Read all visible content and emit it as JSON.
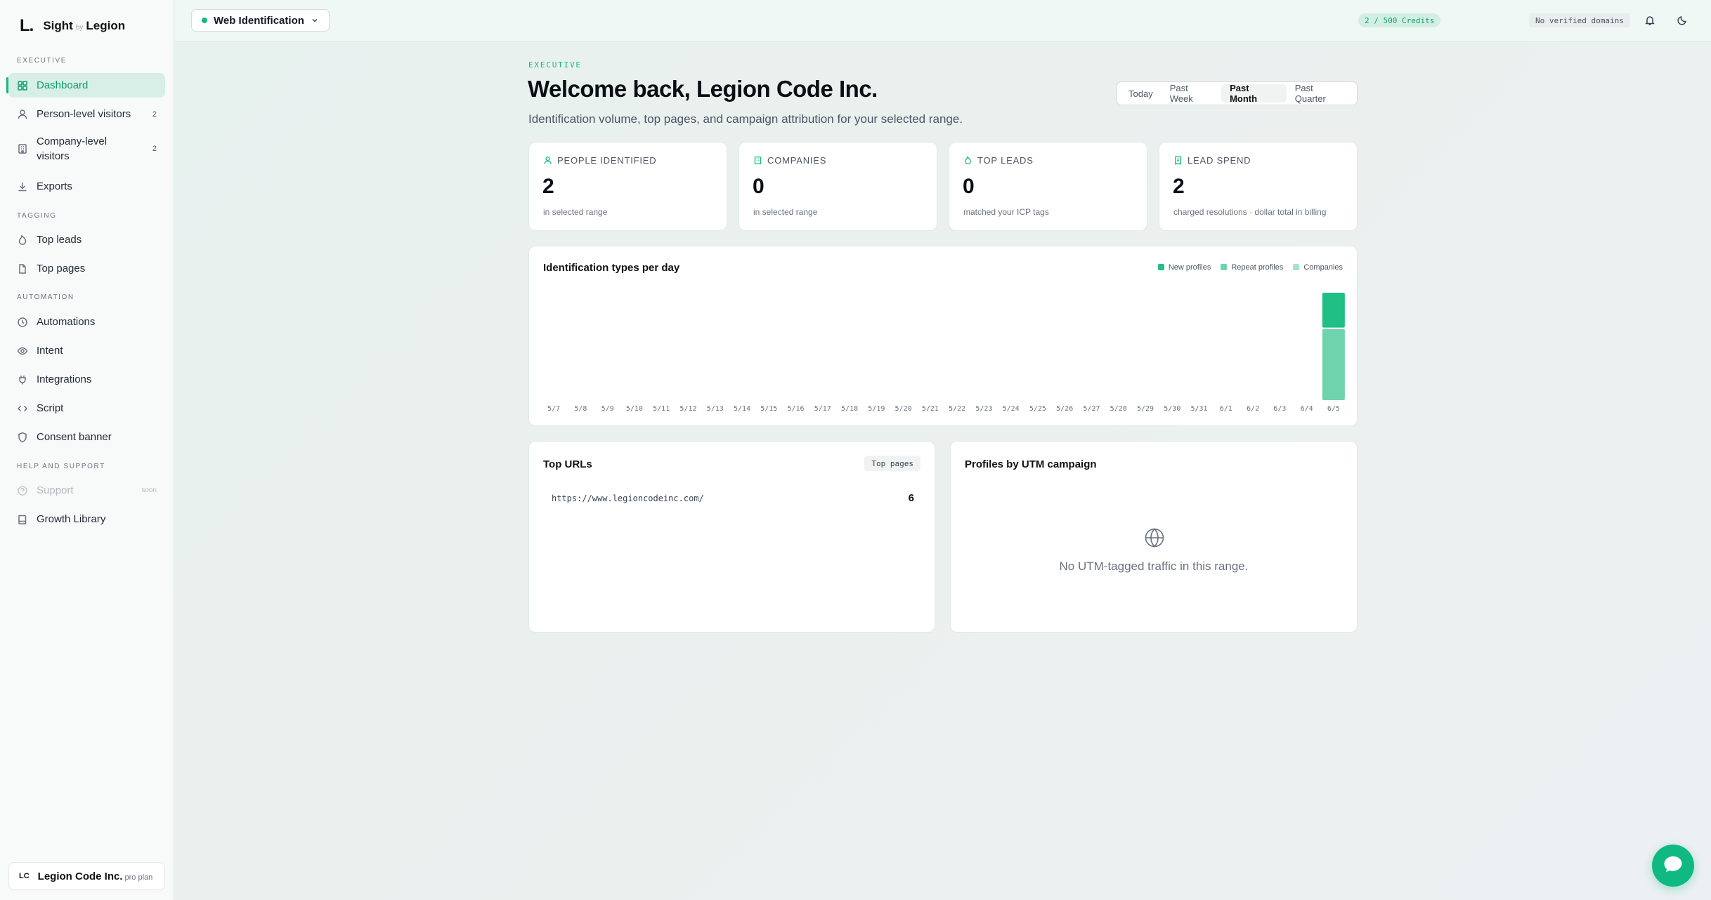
{
  "brand": {
    "logo": "L.",
    "name": "Sight",
    "by": "by",
    "partner": "Legion"
  },
  "sidebar": {
    "sections": [
      "EXECUTIVE",
      "TAGGING",
      "AUTOMATION",
      "HELP AND SUPPORT"
    ],
    "items": [
      {
        "label": "Dashboard",
        "icon": "dashboard-icon",
        "active": true
      },
      {
        "label": "Person-level visitors",
        "icon": "user-icon",
        "count": "2"
      },
      {
        "label": "Company-level visitors",
        "icon": "building-icon",
        "count": "2"
      },
      {
        "label": "Exports",
        "icon": "download-icon"
      },
      {
        "label": "Top leads",
        "icon": "flame-icon"
      },
      {
        "label": "Top pages",
        "icon": "file-icon"
      },
      {
        "label": "Automations",
        "icon": "clock-icon"
      },
      {
        "label": "Intent",
        "icon": "eye-icon"
      },
      {
        "label": "Integrations",
        "icon": "plug-icon"
      },
      {
        "label": "Script",
        "icon": "code-icon"
      },
      {
        "label": "Consent banner",
        "icon": "shield-icon"
      },
      {
        "label": "Support",
        "icon": "help-icon",
        "badge": "soon",
        "disabled": true
      },
      {
        "label": "Growth Library",
        "icon": "book-icon"
      }
    ],
    "account": {
      "initials": "LC",
      "name": "Legion Code Inc.",
      "plan": "pro plan"
    }
  },
  "topbar": {
    "product": "Web Identification",
    "credits": "2 / 500 Credits",
    "domains": "No verified domains"
  },
  "header": {
    "eyebrow": "EXECUTIVE",
    "title": "Welcome back, Legion Code Inc.",
    "subtitle": "Identification volume, top pages, and campaign attribution for your selected range.",
    "ranges": [
      "Today",
      "Past Week",
      "Past Month",
      "Past Quarter"
    ],
    "active_range": "Past Month"
  },
  "stats": [
    {
      "label": "PEOPLE IDENTIFIED",
      "value": "2",
      "note": "in selected range",
      "icon": "user-icon"
    },
    {
      "label": "COMPANIES",
      "value": "0",
      "note": "in selected range",
      "icon": "building-icon"
    },
    {
      "label": "TOP LEADS",
      "value": "0",
      "note": "matched your ICP tags",
      "icon": "flame-icon"
    },
    {
      "label": "LEAD SPEND",
      "value": "2",
      "note": "charged resolutions · dollar total in billing",
      "icon": "receipt-icon"
    }
  ],
  "chart_data": {
    "type": "bar",
    "title": "Identification types per day",
    "categories": [
      "5/7",
      "5/8",
      "5/9",
      "5/10",
      "5/11",
      "5/12",
      "5/13",
      "5/14",
      "5/15",
      "5/16",
      "5/17",
      "5/18",
      "5/19",
      "5/20",
      "5/21",
      "5/22",
      "5/23",
      "5/24",
      "5/25",
      "5/26",
      "5/27",
      "5/28",
      "5/29",
      "5/30",
      "5/31",
      "6/1",
      "6/2",
      "6/3",
      "6/4",
      "6/5"
    ],
    "series": [
      {
        "name": "New profiles",
        "color": "#1fbf85",
        "values": [
          0,
          0,
          0,
          0,
          0,
          0,
          0,
          0,
          0,
          0,
          0,
          0,
          0,
          0,
          0,
          0,
          0,
          0,
          0,
          0,
          0,
          0,
          0,
          0,
          0,
          0,
          0,
          0,
          0,
          1
        ]
      },
      {
        "name": "Repeat profiles",
        "color": "#6fd3ad",
        "values": [
          0,
          0,
          0,
          0,
          0,
          0,
          0,
          0,
          0,
          0,
          0,
          0,
          0,
          0,
          0,
          0,
          0,
          0,
          0,
          0,
          0,
          0,
          0,
          0,
          0,
          0,
          0,
          0,
          0,
          2
        ]
      },
      {
        "name": "Companies",
        "color": "#a7e3cc",
        "values": [
          0,
          0,
          0,
          0,
          0,
          0,
          0,
          0,
          0,
          0,
          0,
          0,
          0,
          0,
          0,
          0,
          0,
          0,
          0,
          0,
          0,
          0,
          0,
          0,
          0,
          0,
          0,
          0,
          0,
          0
        ]
      }
    ],
    "stacked": true,
    "grid": false,
    "legend": "top-right"
  },
  "top_urls": {
    "title": "Top URLs",
    "pill": "Top pages",
    "rows": [
      {
        "url": "https://www.legioncodeinc.com/",
        "count": "6"
      }
    ]
  },
  "utm": {
    "title": "Profiles by UTM campaign",
    "empty": "No UTM-tagged traffic in this range.",
    "icon": "globe-icon"
  },
  "chat": {
    "icon": "chat-icon"
  }
}
